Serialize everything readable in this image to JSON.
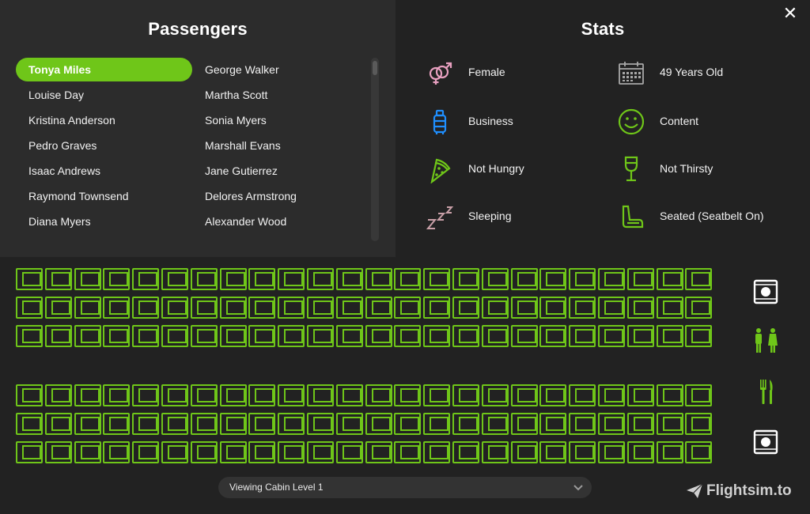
{
  "window": {
    "close_label": "✕"
  },
  "passengers": {
    "title": "Passengers",
    "column1": [
      "Tonya Miles",
      "Louise Day",
      "Kristina Anderson",
      "Pedro Graves",
      "Isaac Andrews",
      "Raymond Townsend",
      "Diana Myers"
    ],
    "column2": [
      "George Walker",
      "Martha Scott",
      "Sonia Myers",
      "Marshall Evans",
      "Jane Gutierrez",
      "Delores Armstrong",
      "Alexander Wood"
    ],
    "selected": "Tonya Miles"
  },
  "stats": {
    "title": "Stats",
    "items": [
      {
        "icon": "gender-icon",
        "label": "Female"
      },
      {
        "icon": "calendar-icon",
        "label": "49 Years Old"
      },
      {
        "icon": "luggage-icon",
        "label": "Business"
      },
      {
        "icon": "smiley-icon",
        "label": "Content"
      },
      {
        "icon": "pizza-icon",
        "label": "Not Hungry"
      },
      {
        "icon": "wine-glass-icon",
        "label": "Not Thirsty"
      },
      {
        "icon": "sleep-icon",
        "label": "Sleeping"
      },
      {
        "icon": "seat-icon",
        "label": "Seated (Seatbelt On)"
      }
    ]
  },
  "seat_map": {
    "seats_per_row": 24,
    "rows": 6,
    "seat_color": "#6fc619",
    "facilities": [
      "galley-icon",
      "lavatory-icon",
      "food-service-icon",
      "galley-icon"
    ]
  },
  "cabin_selector": {
    "label": "Viewing Cabin Level 1"
  },
  "brand": {
    "text": "Flightsim.to"
  },
  "colors": {
    "accent": "#6fc619",
    "female_pink": "#e8a0c0",
    "business_blue": "#1f8fff",
    "sleep_pink": "#c9a0a8",
    "background": "#222222",
    "panel": "#2c2c2c"
  }
}
